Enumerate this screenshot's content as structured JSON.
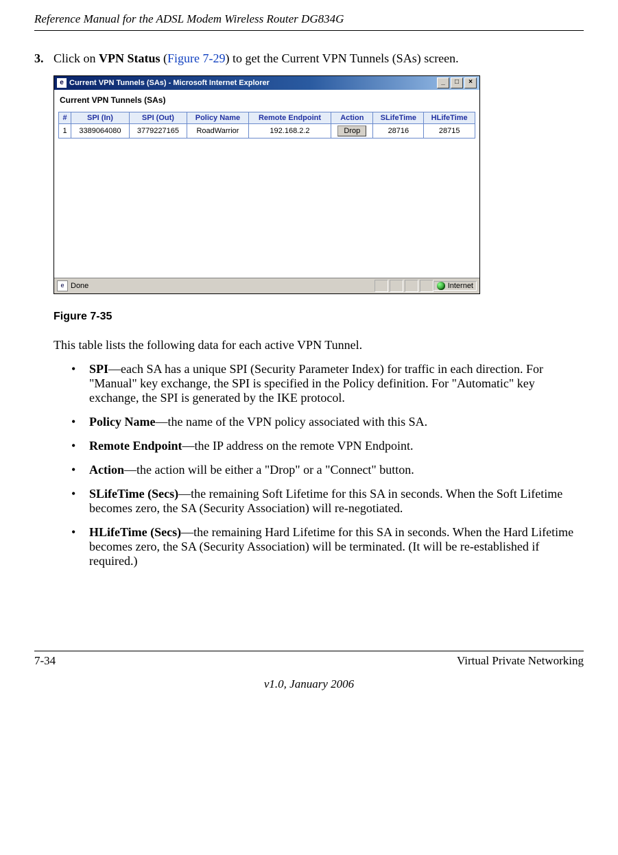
{
  "header": {
    "title": "Reference Manual for the ADSL Modem Wireless Router DG834G"
  },
  "step": {
    "number": "3.",
    "pre": "Click on ",
    "bold": "VPN Status",
    "mid_open": " (",
    "link": "Figure 7-29",
    "mid_close": ") to get the Current VPN Tunnels (SAs) screen."
  },
  "screenshot": {
    "window_title": "Current VPN Tunnels (SAs) - Microsoft Internet Explorer",
    "panel_title": "Current VPN Tunnels (SAs)",
    "headers": [
      "#",
      "SPI (In)",
      "SPI (Out)",
      "Policy Name",
      "Remote Endpoint",
      "Action",
      "SLifeTime",
      "HLifeTime"
    ],
    "row": {
      "num": "1",
      "spi_in": "3389064080",
      "spi_out": "3779227165",
      "policy": "RoadWarrior",
      "remote": "192.168.2.2",
      "action": "Drop",
      "slife": "28716",
      "hlife": "28715"
    },
    "status_done": "Done",
    "status_zone": "Internet"
  },
  "figure_caption": "Figure 7-35",
  "intro_para": "This table lists the following data for each active VPN Tunnel.",
  "definitions": [
    {
      "term": "SPI",
      "text": "—each SA has a unique SPI (Security Parameter Index) for traffic in each direction. For \"Manual\" key exchange, the SPI is specified in the Policy definition. For \"Automatic\" key exchange, the SPI is generated by the IKE protocol."
    },
    {
      "term": "Policy Name",
      "text": "—the name of the VPN policy associated with this SA."
    },
    {
      "term": "Remote Endpoint",
      "text": "—the IP address on the remote VPN Endpoint."
    },
    {
      "term": "Action",
      "text": "—the action will be either a \"Drop\" or a \"Connect\" button."
    },
    {
      "term": "SLifeTime (Secs)",
      "text": "—the remaining Soft Lifetime for this SA in seconds. When the Soft Lifetime becomes zero, the SA (Security Association) will re-negotiated."
    },
    {
      "term": "HLifeTime (Secs)",
      "text": "—the remaining Hard Lifetime for this SA in seconds. When the Hard Lifetime becomes zero, the SA (Security Association) will be terminated. (It will be re-established if required.)"
    }
  ],
  "footer": {
    "page": "7-34",
    "section": "Virtual Private Networking",
    "version": "v1.0, January 2006"
  }
}
